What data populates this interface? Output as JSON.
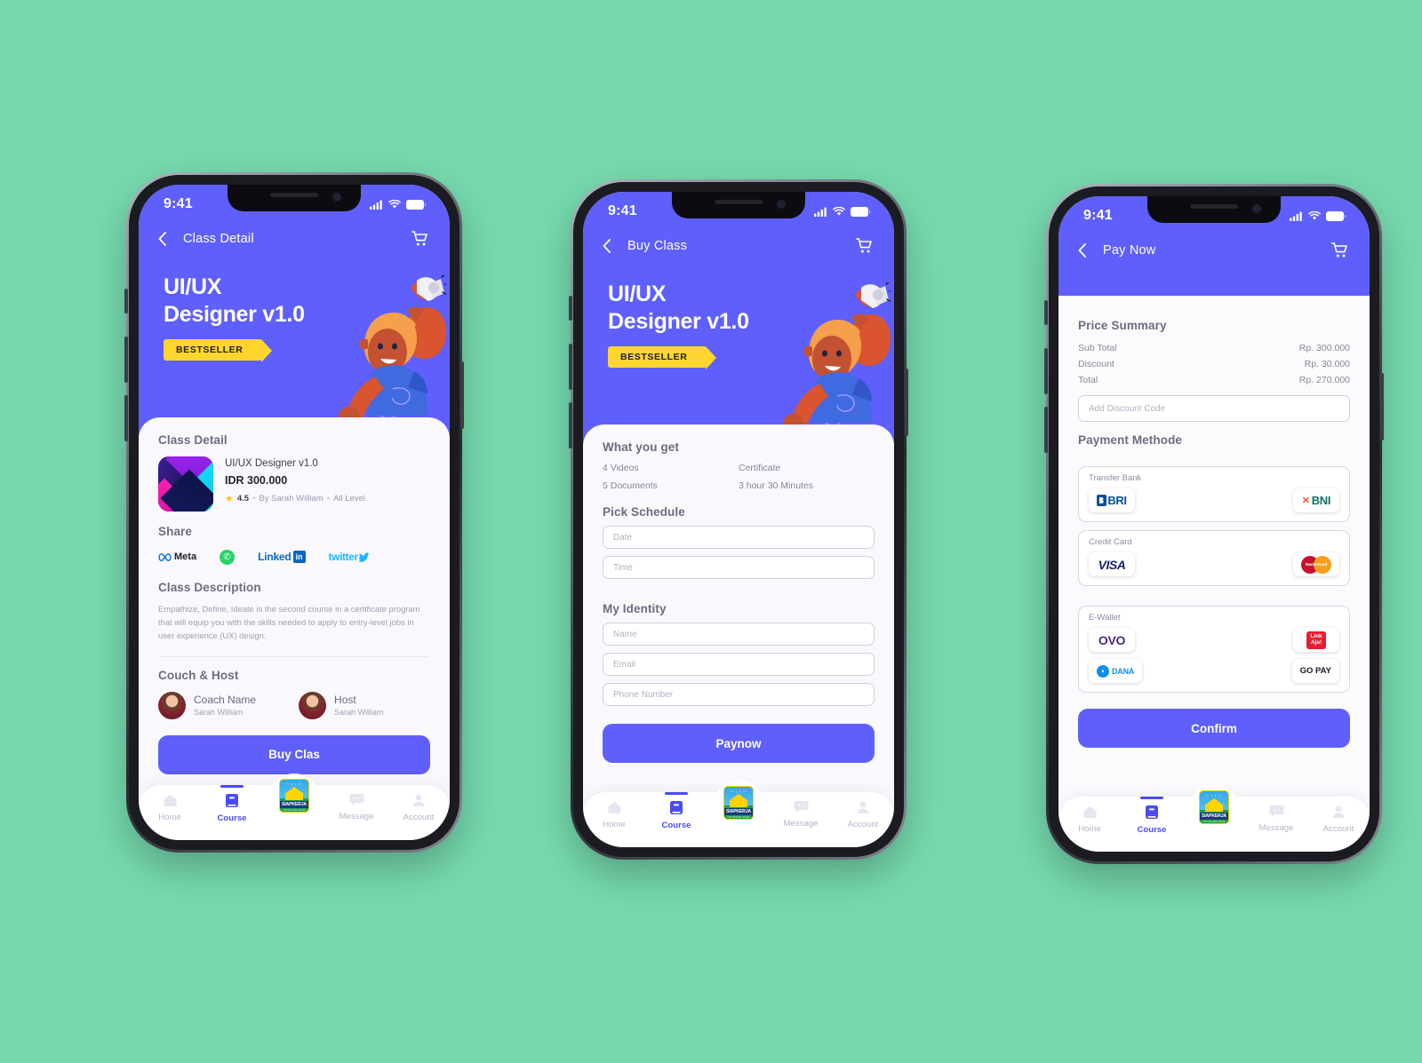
{
  "theme": {
    "background": "#76d9ae",
    "primary": "#5f5ffe",
    "accent_yellow": "#ffd52e",
    "active_tab": "#4b4bf5"
  },
  "statusbar": {
    "time": "9:41"
  },
  "tabbar": {
    "items": [
      {
        "label": "Home",
        "icon": "home-icon",
        "active": false
      },
      {
        "label": "Course",
        "icon": "book-icon",
        "active": true
      },
      {
        "label": "",
        "icon": "siapkerja-logo",
        "active": false
      },
      {
        "label": "Message",
        "icon": "message-icon",
        "active": false
      },
      {
        "label": "Account",
        "icon": "person-icon",
        "active": false
      }
    ],
    "logo": {
      "name": "SIAPKERJA",
      "rays": "\\\\ | | //",
      "tagline": "UNTUK ANAK MUDA"
    }
  },
  "hero": {
    "title_line1": "UI/UX",
    "title_line2": "Designer v1.0",
    "badge": "BESTSELLER"
  },
  "screen1": {
    "nav_title": "Class Detail",
    "section_class_detail": "Class Detail",
    "course": {
      "name": "UI/UX Designer v1.0",
      "price": "IDR 300.000",
      "rating": "4.5",
      "author": "By Sarah William",
      "level": "All Level",
      "separator": "•"
    },
    "share": {
      "heading": "Share",
      "items": [
        {
          "name": "meta-share-icon",
          "label": "Meta"
        },
        {
          "name": "whatsapp-share-icon",
          "label": ""
        },
        {
          "name": "linkedin-share-icon",
          "label": "Linked",
          "badge": "in"
        },
        {
          "name": "twitter-share-icon",
          "label": "twitter"
        }
      ]
    },
    "description": {
      "heading": "Class Description",
      "body": "Empathize, Define, Ideate is the second course in a certificate program that will equip you with the skills needed to apply to entry-level jobs in user experience (UX) design."
    },
    "coach_host": {
      "heading": "Couch & Host",
      "people": [
        {
          "role": "Coach Name",
          "name": "Sarah William"
        },
        {
          "role": "Host",
          "name": "Sarah William"
        }
      ]
    },
    "cta": "Buy Clas"
  },
  "screen2": {
    "nav_title": "Buy Class",
    "what_you_get": {
      "heading": "What you get",
      "items": [
        "4 Videos",
        "Certificate",
        "5 Documents",
        "3 hour 30 Minutes"
      ]
    },
    "pick_schedule": {
      "heading": "Pick Schedule",
      "fields": [
        {
          "name": "date-input",
          "placeholder": "Date",
          "value": ""
        },
        {
          "name": "time-input",
          "placeholder": "Time",
          "value": ""
        }
      ]
    },
    "my_identity": {
      "heading": "My Identity",
      "fields": [
        {
          "name": "name-input",
          "placeholder": "Name",
          "value": ""
        },
        {
          "name": "email-input",
          "placeholder": "Email",
          "value": ""
        },
        {
          "name": "phone-input",
          "placeholder": "Phone Number",
          "value": ""
        }
      ]
    },
    "cta": "Paynow"
  },
  "screen3": {
    "nav_title": "Pay Now",
    "price_summary": {
      "heading": "Price Summary",
      "rows": [
        {
          "label": "Sub Total",
          "value": "Rp. 300.000"
        },
        {
          "label": "Discount",
          "value": "Rp. 30.000"
        },
        {
          "label": "Total",
          "value": "Rp. 270.000"
        }
      ]
    },
    "discount_input": {
      "placeholder": "Add Discount Code",
      "value": ""
    },
    "payment": {
      "heading": "Payment Methode",
      "groups": [
        {
          "label": "Transfer Bank",
          "options": [
            {
              "name": "bri-option",
              "label": "BRI"
            },
            {
              "name": "bni-option",
              "label": "BNI"
            }
          ]
        },
        {
          "label": "Credit Card",
          "options": [
            {
              "name": "visa-option",
              "label": "VISA"
            },
            {
              "name": "mastercard-option",
              "label": "MasterCard"
            }
          ]
        },
        {
          "label": "E-Wallet",
          "options": [
            {
              "name": "ovo-option",
              "label": "OVO"
            },
            {
              "name": "linkaja-option",
              "label": "Link Aja!"
            },
            {
              "name": "dana-option",
              "label": "DANA"
            },
            {
              "name": "gopay-option",
              "label": "GO PAY"
            }
          ]
        }
      ]
    },
    "cta": "Confirm"
  }
}
